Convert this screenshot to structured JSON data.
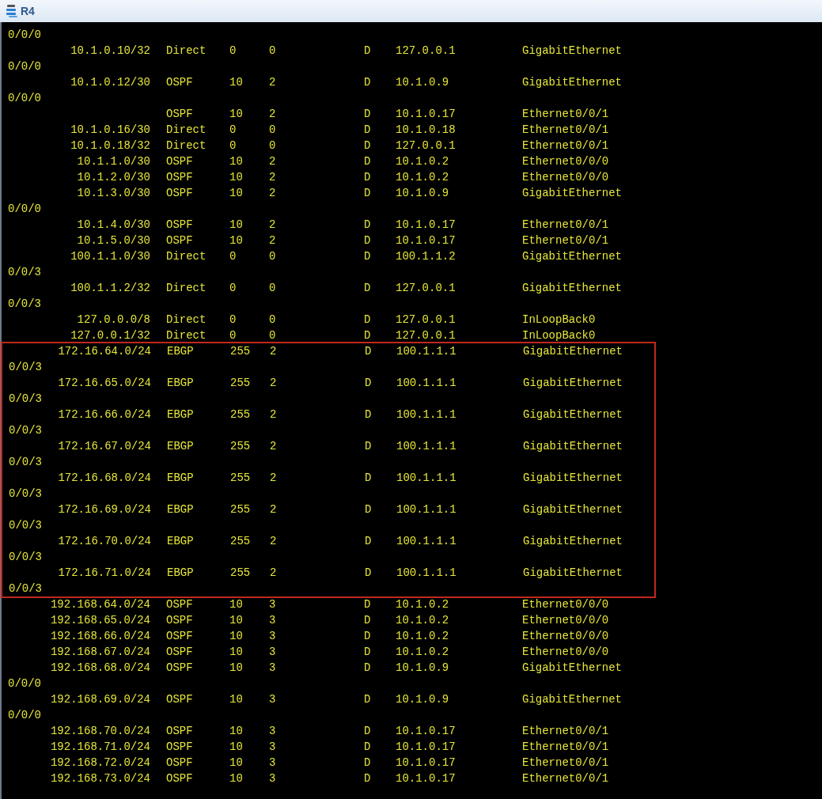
{
  "window": {
    "title": "R4"
  },
  "blocks": [
    {
      "highlighted": false,
      "lines": [
        {
          "kind": "wrap",
          "text": "0/0/0"
        },
        {
          "kind": "route",
          "destination": "10.1.0.10/32",
          "proto": "Direct",
          "pre": "0",
          "cost": "0",
          "flags": "D",
          "nexthop": "127.0.0.1",
          "interface": "GigabitEthernet"
        },
        {
          "kind": "wrap",
          "text": "0/0/0"
        },
        {
          "kind": "route",
          "destination": "10.1.0.12/30",
          "proto": "OSPF",
          "pre": "10",
          "cost": "2",
          "flags": "D",
          "nexthop": "10.1.0.9",
          "interface": "GigabitEthernet"
        },
        {
          "kind": "wrap",
          "text": "0/0/0"
        },
        {
          "kind": "route",
          "proto": "OSPF",
          "pre": "10",
          "cost": "2",
          "flags": "D",
          "nexthop": "10.1.0.17",
          "interface": "Ethernet0/0/1"
        },
        {
          "kind": "route",
          "destination": "10.1.0.16/30",
          "proto": "Direct",
          "pre": "0",
          "cost": "0",
          "flags": "D",
          "nexthop": "10.1.0.18",
          "interface": "Ethernet0/0/1"
        },
        {
          "kind": "route",
          "destination": "10.1.0.18/32",
          "proto": "Direct",
          "pre": "0",
          "cost": "0",
          "flags": "D",
          "nexthop": "127.0.0.1",
          "interface": "Ethernet0/0/1"
        },
        {
          "kind": "route",
          "destination": "10.1.1.0/30",
          "proto": "OSPF",
          "pre": "10",
          "cost": "2",
          "flags": "D",
          "nexthop": "10.1.0.2",
          "interface": "Ethernet0/0/0"
        },
        {
          "kind": "route",
          "destination": "10.1.2.0/30",
          "proto": "OSPF",
          "pre": "10",
          "cost": "2",
          "flags": "D",
          "nexthop": "10.1.0.2",
          "interface": "Ethernet0/0/0"
        },
        {
          "kind": "route",
          "destination": "10.1.3.0/30",
          "proto": "OSPF",
          "pre": "10",
          "cost": "2",
          "flags": "D",
          "nexthop": "10.1.0.9",
          "interface": "GigabitEthernet"
        },
        {
          "kind": "wrap",
          "text": "0/0/0"
        },
        {
          "kind": "route",
          "destination": "10.1.4.0/30",
          "proto": "OSPF",
          "pre": "10",
          "cost": "2",
          "flags": "D",
          "nexthop": "10.1.0.17",
          "interface": "Ethernet0/0/1"
        },
        {
          "kind": "route",
          "destination": "10.1.5.0/30",
          "proto": "OSPF",
          "pre": "10",
          "cost": "2",
          "flags": "D",
          "nexthop": "10.1.0.17",
          "interface": "Ethernet0/0/1"
        },
        {
          "kind": "route",
          "destination": "100.1.1.0/30",
          "proto": "Direct",
          "pre": "0",
          "cost": "0",
          "flags": "D",
          "nexthop": "100.1.1.2",
          "interface": "GigabitEthernet"
        },
        {
          "kind": "wrap",
          "text": "0/0/3"
        },
        {
          "kind": "route",
          "destination": "100.1.1.2/32",
          "proto": "Direct",
          "pre": "0",
          "cost": "0",
          "flags": "D",
          "nexthop": "127.0.0.1",
          "interface": "GigabitEthernet"
        },
        {
          "kind": "wrap",
          "text": "0/0/3"
        },
        {
          "kind": "route",
          "destination": "127.0.0.0/8",
          "proto": "Direct",
          "pre": "0",
          "cost": "0",
          "flags": "D",
          "nexthop": "127.0.0.1",
          "interface": "InLoopBack0"
        },
        {
          "kind": "route",
          "destination": "127.0.0.1/32",
          "proto": "Direct",
          "pre": "0",
          "cost": "0",
          "flags": "D",
          "nexthop": "127.0.0.1",
          "interface": "InLoopBack0"
        }
      ]
    },
    {
      "highlighted": true,
      "lines": [
        {
          "kind": "route",
          "destination": "172.16.64.0/24",
          "proto": "EBGP",
          "pre": "255",
          "cost": "2",
          "flags": "D",
          "nexthop": "100.1.1.1",
          "interface": "GigabitEthernet"
        },
        {
          "kind": "wrap",
          "text": "0/0/3"
        },
        {
          "kind": "route",
          "destination": "172.16.65.0/24",
          "proto": "EBGP",
          "pre": "255",
          "cost": "2",
          "flags": "D",
          "nexthop": "100.1.1.1",
          "interface": "GigabitEthernet"
        },
        {
          "kind": "wrap",
          "text": "0/0/3"
        },
        {
          "kind": "route",
          "destination": "172.16.66.0/24",
          "proto": "EBGP",
          "pre": "255",
          "cost": "2",
          "flags": "D",
          "nexthop": "100.1.1.1",
          "interface": "GigabitEthernet"
        },
        {
          "kind": "wrap",
          "text": "0/0/3"
        },
        {
          "kind": "route",
          "destination": "172.16.67.0/24",
          "proto": "EBGP",
          "pre": "255",
          "cost": "2",
          "flags": "D",
          "nexthop": "100.1.1.1",
          "interface": "GigabitEthernet"
        },
        {
          "kind": "wrap",
          "text": "0/0/3"
        },
        {
          "kind": "route",
          "destination": "172.16.68.0/24",
          "proto": "EBGP",
          "pre": "255",
          "cost": "2",
          "flags": "D",
          "nexthop": "100.1.1.1",
          "interface": "GigabitEthernet"
        },
        {
          "kind": "wrap",
          "text": "0/0/3"
        },
        {
          "kind": "route",
          "destination": "172.16.69.0/24",
          "proto": "EBGP",
          "pre": "255",
          "cost": "2",
          "flags": "D",
          "nexthop": "100.1.1.1",
          "interface": "GigabitEthernet"
        },
        {
          "kind": "wrap",
          "text": "0/0/3"
        },
        {
          "kind": "route",
          "destination": "172.16.70.0/24",
          "proto": "EBGP",
          "pre": "255",
          "cost": "2",
          "flags": "D",
          "nexthop": "100.1.1.1",
          "interface": "GigabitEthernet"
        },
        {
          "kind": "wrap",
          "text": "0/0/3"
        },
        {
          "kind": "route",
          "destination": "172.16.71.0/24",
          "proto": "EBGP",
          "pre": "255",
          "cost": "2",
          "flags": "D",
          "nexthop": "100.1.1.1",
          "interface": "GigabitEthernet"
        },
        {
          "kind": "wrap",
          "text": "0/0/3"
        }
      ]
    },
    {
      "highlighted": false,
      "lines": [
        {
          "kind": "route",
          "destination": "192.168.64.0/24",
          "proto": "OSPF",
          "pre": "10",
          "cost": "3",
          "flags": "D",
          "nexthop": "10.1.0.2",
          "interface": "Ethernet0/0/0"
        },
        {
          "kind": "route",
          "destination": "192.168.65.0/24",
          "proto": "OSPF",
          "pre": "10",
          "cost": "3",
          "flags": "D",
          "nexthop": "10.1.0.2",
          "interface": "Ethernet0/0/0"
        },
        {
          "kind": "route",
          "destination": "192.168.66.0/24",
          "proto": "OSPF",
          "pre": "10",
          "cost": "3",
          "flags": "D",
          "nexthop": "10.1.0.2",
          "interface": "Ethernet0/0/0"
        },
        {
          "kind": "route",
          "destination": "192.168.67.0/24",
          "proto": "OSPF",
          "pre": "10",
          "cost": "3",
          "flags": "D",
          "nexthop": "10.1.0.2",
          "interface": "Ethernet0/0/0"
        },
        {
          "kind": "route",
          "destination": "192.168.68.0/24",
          "proto": "OSPF",
          "pre": "10",
          "cost": "3",
          "flags": "D",
          "nexthop": "10.1.0.9",
          "interface": "GigabitEthernet"
        },
        {
          "kind": "wrap",
          "text": "0/0/0"
        },
        {
          "kind": "route",
          "destination": "192.168.69.0/24",
          "proto": "OSPF",
          "pre": "10",
          "cost": "3",
          "flags": "D",
          "nexthop": "10.1.0.9",
          "interface": "GigabitEthernet"
        },
        {
          "kind": "wrap",
          "text": "0/0/0"
        },
        {
          "kind": "route",
          "destination": "192.168.70.0/24",
          "proto": "OSPF",
          "pre": "10",
          "cost": "3",
          "flags": "D",
          "nexthop": "10.1.0.17",
          "interface": "Ethernet0/0/1"
        },
        {
          "kind": "route",
          "destination": "192.168.71.0/24",
          "proto": "OSPF",
          "pre": "10",
          "cost": "3",
          "flags": "D",
          "nexthop": "10.1.0.17",
          "interface": "Ethernet0/0/1"
        },
        {
          "kind": "route",
          "destination": "192.168.72.0/24",
          "proto": "OSPF",
          "pre": "10",
          "cost": "3",
          "flags": "D",
          "nexthop": "10.1.0.17",
          "interface": "Ethernet0/0/1"
        },
        {
          "kind": "route",
          "destination": "192.168.73.0/24",
          "proto": "OSPF",
          "pre": "10",
          "cost": "3",
          "flags": "D",
          "nexthop": "10.1.0.17",
          "interface": "Ethernet0/0/1"
        }
      ]
    }
  ]
}
